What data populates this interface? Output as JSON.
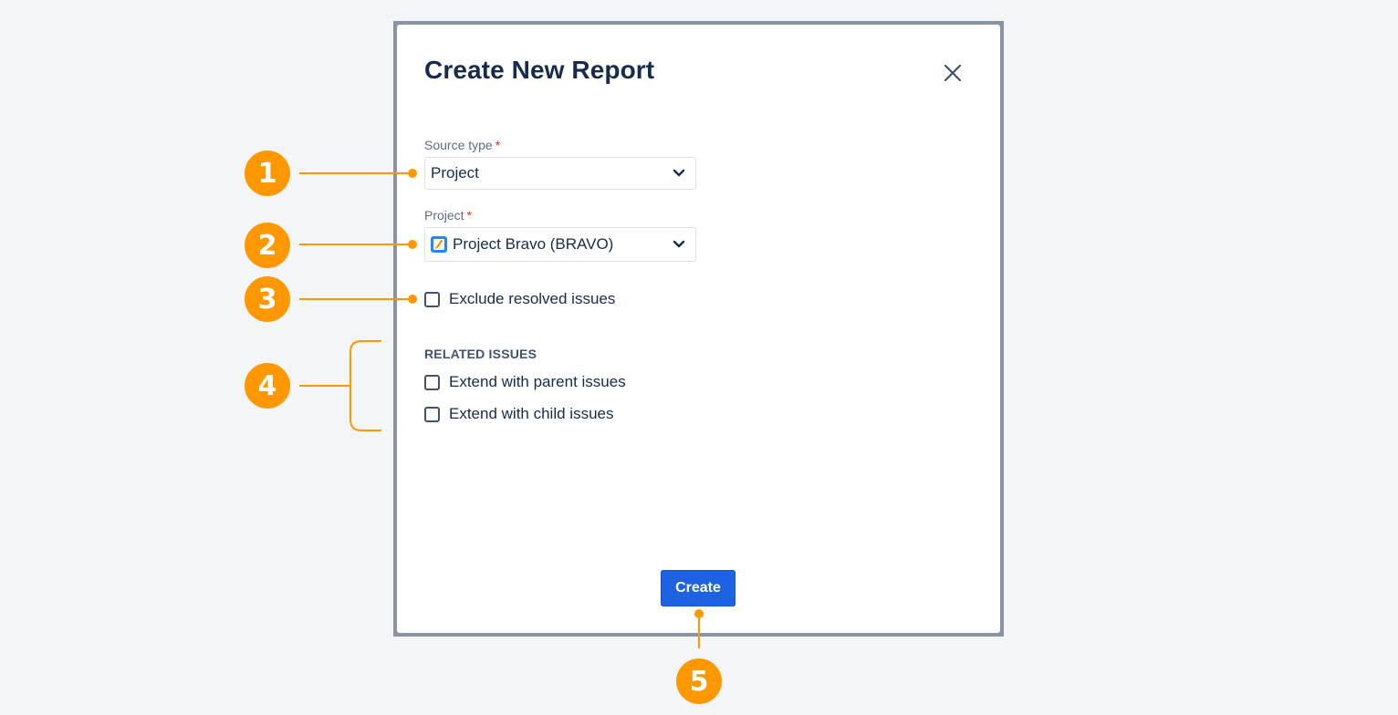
{
  "dialog": {
    "title": "Create New Report",
    "close_icon": "close-icon"
  },
  "form": {
    "source_type": {
      "label": "Source type",
      "required_mark": "*",
      "value": "Project"
    },
    "project": {
      "label": "Project",
      "required_mark": "*",
      "value": "Project Bravo (BRAVO)",
      "icon": "project-icon"
    },
    "exclude_resolved": {
      "label": "Exclude resolved issues",
      "checked": false
    },
    "related_issues": {
      "heading": "RELATED ISSUES",
      "options": [
        {
          "label": "Extend with parent issues",
          "checked": false
        },
        {
          "label": "Extend with child issues",
          "checked": false
        }
      ]
    },
    "create_label": "Create"
  },
  "callouts": [
    "1",
    "2",
    "3",
    "4",
    "5"
  ],
  "colors": {
    "accent": "#ff9800",
    "primary_button": "#1d62e0",
    "frame": "#8993a4",
    "background": "#f4f5f7",
    "title_text": "#172b4d",
    "required": "#de350b"
  }
}
